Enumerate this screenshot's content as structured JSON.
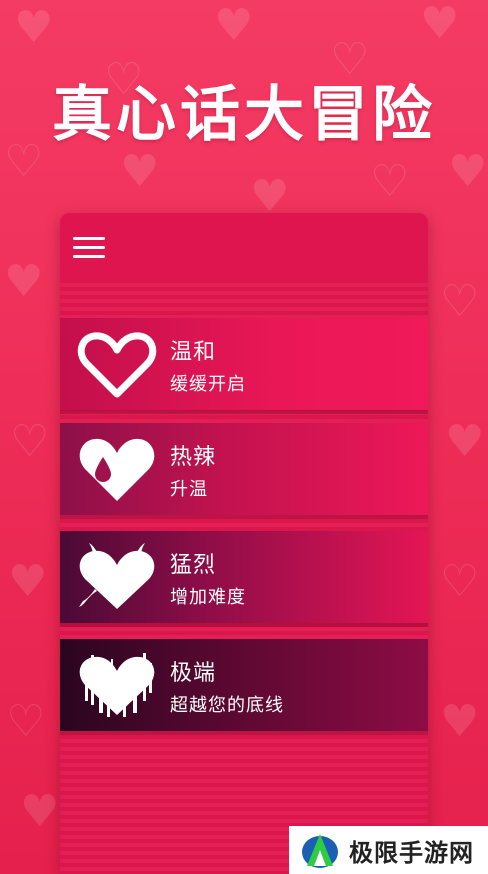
{
  "app": {
    "title": "真心话大冒险"
  },
  "menu": {
    "icon": "hamburger-menu-icon"
  },
  "levels": [
    {
      "name": "温和",
      "description": "缓缓开启",
      "icon": "heart-outline-icon"
    },
    {
      "name": "热辣",
      "description": "升温",
      "icon": "heart-drop-icon"
    },
    {
      "name": "猛烈",
      "description": "增加难度",
      "icon": "devil-heart-icon"
    },
    {
      "name": "极端",
      "description": "超越您的底线",
      "icon": "glitch-heart-icon"
    }
  ],
  "watermark": {
    "text": "极限手游网",
    "logo": "watermark-logo-icon"
  },
  "colors": {
    "background": "#ee2e58",
    "panel": "#e2174f",
    "text": "#ffffff"
  }
}
